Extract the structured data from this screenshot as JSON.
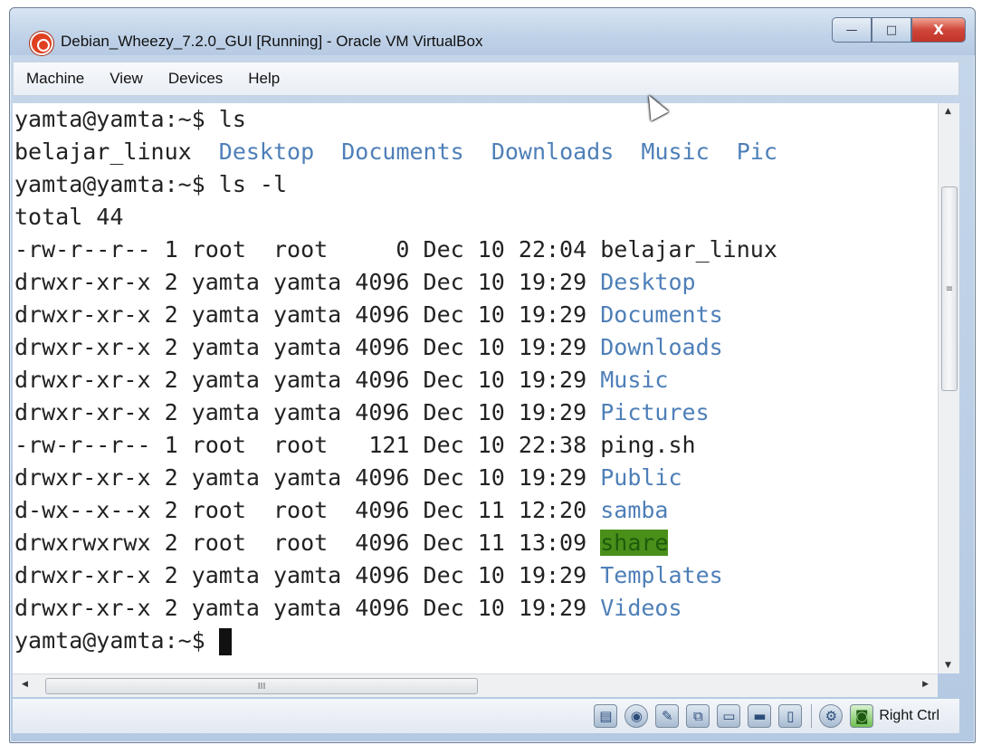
{
  "window": {
    "title": "Debian_Wheezy_7.2.0_GUI [Running] - Oracle VM VirtualBox",
    "controls": {
      "minimize": "—",
      "maximize": "□",
      "close": "X"
    }
  },
  "menubar": {
    "items": [
      "Machine",
      "View",
      "Devices",
      "Help"
    ]
  },
  "terminal": {
    "lines": [
      [
        {
          "t": "yamta@yamta:~$ ls",
          "k": "plain"
        }
      ],
      [
        {
          "t": "belajar_linux  ",
          "k": "plain"
        },
        {
          "t": "Desktop",
          "k": "dir"
        },
        {
          "t": "  ",
          "k": "plain"
        },
        {
          "t": "Documents",
          "k": "dir"
        },
        {
          "t": "  ",
          "k": "plain"
        },
        {
          "t": "Downloads",
          "k": "dir"
        },
        {
          "t": "  ",
          "k": "plain"
        },
        {
          "t": "Music",
          "k": "dir"
        },
        {
          "t": "  ",
          "k": "plain"
        },
        {
          "t": "Pic",
          "k": "dir"
        }
      ],
      [
        {
          "t": "yamta@yamta:~$ ls -l",
          "k": "plain"
        }
      ],
      [
        {
          "t": "total 44",
          "k": "plain"
        }
      ],
      [
        {
          "t": "-rw-r--r-- 1 root  root     0 Dec 10 22:04 ",
          "k": "plain"
        },
        {
          "t": "belajar_linux",
          "k": "plain"
        }
      ],
      [
        {
          "t": "drwxr-xr-x 2 yamta yamta 4096 Dec 10 19:29 ",
          "k": "plain"
        },
        {
          "t": "Desktop",
          "k": "dir"
        }
      ],
      [
        {
          "t": "drwxr-xr-x 2 yamta yamta 4096 Dec 10 19:29 ",
          "k": "plain"
        },
        {
          "t": "Documents",
          "k": "dir"
        }
      ],
      [
        {
          "t": "drwxr-xr-x 2 yamta yamta 4096 Dec 10 19:29 ",
          "k": "plain"
        },
        {
          "t": "Downloads",
          "k": "dir"
        }
      ],
      [
        {
          "t": "drwxr-xr-x 2 yamta yamta 4096 Dec 10 19:29 ",
          "k": "plain"
        },
        {
          "t": "Music",
          "k": "dir"
        }
      ],
      [
        {
          "t": "drwxr-xr-x 2 yamta yamta 4096 Dec 10 19:29 ",
          "k": "plain"
        },
        {
          "t": "Pictures",
          "k": "dir"
        }
      ],
      [
        {
          "t": "-rw-r--r-- 1 root  root   121 Dec 10 22:38 ",
          "k": "plain"
        },
        {
          "t": "ping.sh",
          "k": "plain"
        }
      ],
      [
        {
          "t": "drwxr-xr-x 2 yamta yamta 4096 Dec 10 19:29 ",
          "k": "plain"
        },
        {
          "t": "Public",
          "k": "dir"
        }
      ],
      [
        {
          "t": "d-wx--x--x 2 root  root  4096 Dec 11 12:20 ",
          "k": "plain"
        },
        {
          "t": "samba",
          "k": "dir"
        }
      ],
      [
        {
          "t": "drwxrwxrwx 2 root  root  4096 Dec 11 13:09 ",
          "k": "plain"
        },
        {
          "t": "share",
          "k": "hl"
        }
      ],
      [
        {
          "t": "drwxr-xr-x 2 yamta yamta 4096 Dec 10 19:29 ",
          "k": "plain"
        },
        {
          "t": "Templates",
          "k": "dir"
        }
      ],
      [
        {
          "t": "drwxr-xr-x 2 yamta yamta 4096 Dec 10 19:29 ",
          "k": "plain"
        },
        {
          "t": "Videos",
          "k": "dir"
        }
      ],
      [
        {
          "t": "yamta@yamta:~$ ",
          "k": "plain"
        },
        {
          "t": "",
          "k": "cursor"
        }
      ]
    ]
  },
  "scrollbars": {
    "vertical_grip": "≡",
    "horizontal_grip": "III"
  },
  "statusbar": {
    "icons": [
      "hard-disk-icon",
      "optical-drive-icon",
      "usb-icon",
      "network-icon",
      "shared-folders-icon",
      "display-icon",
      "video-capture-icon",
      "virtualization-icon",
      "mouse-integration-icon"
    ],
    "host_key": "Right Ctrl"
  },
  "colors": {
    "directory": "#4e7fb8",
    "highlight_bg": "#4a8f1a",
    "text": "#222222"
  }
}
